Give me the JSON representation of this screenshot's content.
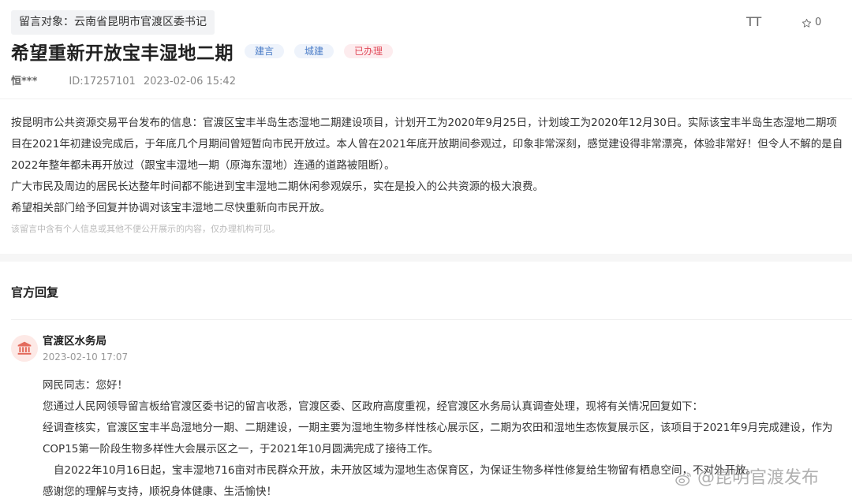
{
  "header": {
    "target_tag": "留言对象：云南省昆明市官渡区委书记",
    "font_size_label": "TT",
    "star_count": "0"
  },
  "message": {
    "title": "希望重新开放宝丰湿地二期",
    "badges": [
      {
        "label": "建言",
        "color": "#4a7cc7"
      },
      {
        "label": "城建",
        "color": "#4a7cc7"
      },
      {
        "label": "已办理",
        "color": "#e14b5a"
      }
    ],
    "author": "恒***",
    "id": "ID:17257101",
    "datetime": "2023-02-06 15:42",
    "paragraphs": [
      "按昆明市公共资源交易平台发布的信息：官渡区宝丰半岛生态湿地二期建设项目，计划开工为2020年9月25日，计划竣工为2020年12月30日。实际该宝丰半岛生态湿地二期项目在2021年初建设完成后，于年底几个月期间曾短暂向市民开放过。本人曾在2021年底开放期间参观过，印象非常深刻，感觉建设得非常漂亮，体验非常好！但令人不解的是自2022年整年都未再开放过（跟宝丰湿地一期（原海东湿地）连通的道路被阻断）。",
      "广大市民及周边的居民长达整年时间都不能进到宝丰湿地二期休闲参观娱乐，实在是投入的公共资源的极大浪费。",
      "希望相关部门给予回复并协调对该宝丰湿地二尽快重新向市民开放。"
    ],
    "privacy_note": "该留言中含有个人信息或其他不便公开展示的内容，仅办理机构可见。"
  },
  "official_reply": {
    "section_title": "官方回复",
    "department": "官渡区水务局",
    "datetime": "2023-02-10 17:07",
    "paragraphs": [
      "网民同志：您好！",
      "您通过人民网领导留言板给官渡区委书记的留言收悉，官渡区委、区政府高度重视，经官渡区水务局认真调查处理，现将有关情况回复如下：",
      "经调查核实，官渡区宝丰半岛湿地分一期、二期建设，一期主要为湿地生物多样性核心展示区，二期为农田和湿地生态恢复展示区，该项目于2021年9月完成建设，作为COP15第一阶段生物多样性大会展示区之一，于2021年10月圆满完成了接待工作。",
      "自2022年10月16日起，宝丰湿地716亩对市民群众开放，未开放区域为湿地生态保育区，为保证生物多样性修复给生物留有栖息空间，不对外开放。",
      "感谢您的理解与支持，顺祝身体健康、生活愉快！"
    ]
  },
  "watermark": {
    "text": "@昆明官渡发布"
  }
}
